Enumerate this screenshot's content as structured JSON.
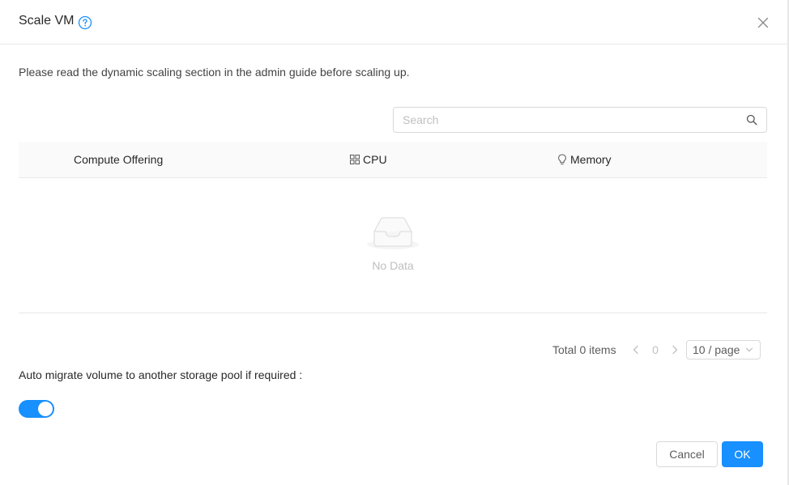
{
  "dialog": {
    "title": "Scale VM",
    "notice": "Please read the dynamic scaling section in the admin guide before scaling up."
  },
  "search": {
    "placeholder": "Search",
    "value": ""
  },
  "table": {
    "columns": [
      {
        "label": "Compute Offering",
        "icon": ""
      },
      {
        "label": "CPU",
        "icon": "appstore-icon"
      },
      {
        "label": "Memory",
        "icon": "bulb-icon"
      }
    ],
    "empty_text": "No Data"
  },
  "pagination": {
    "total_text": "Total 0 items",
    "current_page": "0",
    "page_size": "10 / page"
  },
  "auto_migrate": {
    "label": "Auto migrate volume to another storage pool if required :",
    "enabled": true
  },
  "footer": {
    "cancel_label": "Cancel",
    "ok_label": "OK"
  },
  "colors": {
    "accent": "#1890ff",
    "border": "#e8e8e8",
    "muted": "#bfbfbf"
  }
}
